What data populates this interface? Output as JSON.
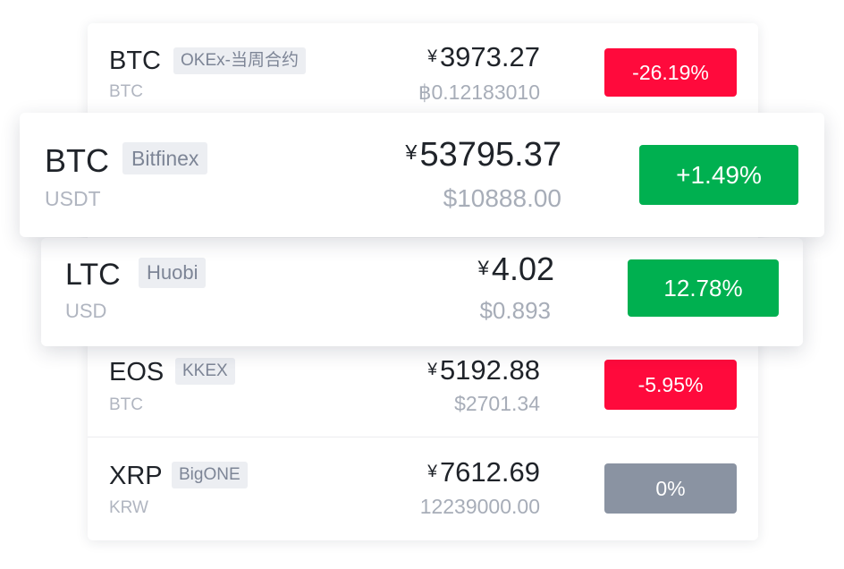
{
  "colors": {
    "down": "#ff0a3c",
    "up": "#00b050",
    "flat": "#8a93a2"
  },
  "rows": [
    {
      "symbol": "BTC",
      "exchange": "OKEx-当周合约",
      "quote": "BTC",
      "currency_symbol": "¥",
      "price": "3973.27",
      "converted": "฿0.12183010",
      "change": "-26.19%",
      "trend": "down"
    },
    {
      "symbol": "BTC",
      "exchange": "Bitfinex",
      "quote": "USDT",
      "currency_symbol": "¥",
      "price": "53795.37",
      "converted": "$10888.00",
      "change": "+1.49%",
      "trend": "up"
    },
    {
      "symbol": "LTC",
      "exchange": "Huobi",
      "quote": "USD",
      "currency_symbol": "¥",
      "price": "4.02",
      "converted": "$0.893",
      "change": "12.78%",
      "trend": "up"
    },
    {
      "symbol": "EOS",
      "exchange": "KKEX",
      "quote": "BTC",
      "currency_symbol": "¥",
      "price": "5192.88",
      "converted": "$2701.34",
      "change": "-5.95%",
      "trend": "down"
    },
    {
      "symbol": "XRP",
      "exchange": "BigONE",
      "quote": "KRW",
      "currency_symbol": "¥",
      "price": "7612.69",
      "converted": "12239000.00",
      "change": "0%",
      "trend": "flat"
    }
  ]
}
